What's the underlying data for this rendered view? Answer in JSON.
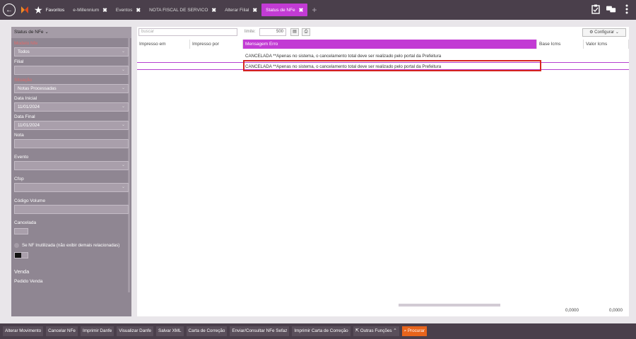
{
  "topbar": {
    "tabs": [
      {
        "label": "Favoritos"
      },
      {
        "label": "e-Millennium"
      },
      {
        "label": "Eventos"
      },
      {
        "label": "NOTA FISCAL DE SERVICO"
      },
      {
        "label": "Alterar Filial"
      },
      {
        "label": "Status de NFe",
        "active": true
      }
    ],
    "close_glyph": "✖",
    "plus_glyph": "+"
  },
  "sidebar": {
    "title": "Status de NFe ⌄",
    "modelo_label": "Modelo Nfe",
    "modelo_value": "Todos",
    "filial_label": "Filial",
    "filial_value": "",
    "situacao_label": "Situação",
    "situacao_value": "Notas Processadas",
    "data_inicial_label": "Data Inicial",
    "data_inicial_value": "11/01/2024",
    "data_final_label": "Data Final",
    "data_final_value": "11/01/2024",
    "nota_label": "Nota",
    "nota_value": "",
    "evento_label": "Evento",
    "evento_value": "",
    "cfop_label": "Cfop",
    "cfop_value": "",
    "codigo_volume_label": "Código Volume",
    "codigo_volume_value": "",
    "cancelada_label": "Cancelada",
    "inutilizada_label": "Se NF Inutilizada (não exibir demais relacionadas)",
    "venda_section": "Venda",
    "pedido_venda_label": "Pedido Venda"
  },
  "toolbar": {
    "search_placeholder": "buscar",
    "limite_label": "limite:",
    "limite_value": "500",
    "configurar_label": "⚙ Configurar ⌄"
  },
  "table": {
    "columns": [
      "Impresso em",
      "Impresso por",
      "Mensagem Erro",
      "Base Icms",
      "Valor Icms"
    ],
    "rows": [
      {
        "mensagem": "CANCELADA **Apenas no sistema, o cancelamento total deve ser realizado pelo portal da Prefeitura"
      },
      {
        "mensagem": "CANCELADA **Apenas no sistema, o cancelamento total deve ser realizado pelo portal da Prefeitura"
      }
    ],
    "totals": {
      "base_icms": "0,0000",
      "valor_icms": "0,0000"
    }
  },
  "bottombar": {
    "buttons": [
      "Alterar Movimento",
      "Cancelar NFe",
      "Imprimir Danfe",
      "Visualizar Danfe",
      "Salvar XML",
      "Carta de Correção",
      "Enviar/Consultar NFe Sefaz",
      "Imprimir Carta de Correção",
      "Outras Funções",
      "Procurar"
    ]
  },
  "colors": {
    "accent": "#c23bd4",
    "bar": "#4a3f4b",
    "sidebar": "#8f8692",
    "highlight_border": "#d6241f",
    "search_button": "#e7641c"
  }
}
